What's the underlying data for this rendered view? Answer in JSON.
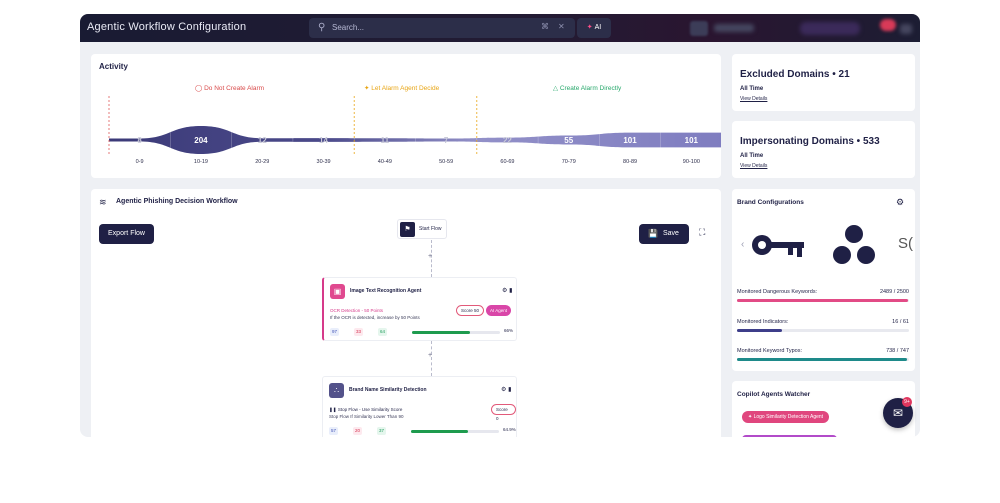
{
  "app": {
    "title": "Agentic Workflow Configuration"
  },
  "search": {
    "placeholder": "Search...",
    "ai_label": "AI"
  },
  "activity": {
    "title": "Activity",
    "zones": [
      {
        "label": "Do Not Create Alarm",
        "color": "#d94a4a"
      },
      {
        "label": "Let Alarm Agent Decide",
        "color": "#e8a514"
      },
      {
        "label": "Create Alarm Directly",
        "color": "#27a86b"
      }
    ],
    "bins": [
      "0-9",
      "10-19",
      "20-29",
      "30-39",
      "40-49",
      "50-59",
      "60-69",
      "70-79",
      "80-89",
      "90-100"
    ],
    "values": [
      8,
      204,
      12,
      14,
      11,
      7,
      22,
      55,
      101,
      101
    ]
  },
  "excluded_domains": {
    "title": "Excluded Domains • 21",
    "period": "All Time",
    "link": "View Details"
  },
  "impersonating_domains": {
    "title": "Impersonating Domains • 533",
    "period": "All Time",
    "link": "View Details"
  },
  "workflow": {
    "title": "Agentic Phishing Decision Workflow",
    "export_label": "Export Flow",
    "start_label": "Start Flow",
    "save_label": "Save",
    "plus": "+",
    "nodes": [
      {
        "title": "Image Text Recognition Agent",
        "line1": "OCR Detection - 50 Points",
        "line2": "If the OCR is detected, increase by 50 Points",
        "score": "Score 50",
        "agent": "AI Agent",
        "stat1": "97",
        "stat2": "33",
        "stat3": "64",
        "progress": 0.66,
        "progress_label": "66%"
      },
      {
        "title": "Brand Name Similarity Detection",
        "line1": "Stop Flow - Use Similarity Score",
        "line2": "Stop Flow If Similarity Lower Than 90",
        "score": "Score 0",
        "stat1": "57",
        "stat2": "20",
        "stat3": "37",
        "progress": 0.649,
        "progress_label": "64.9%"
      }
    ]
  },
  "brand": {
    "title": "Brand Configurations",
    "metrics": [
      {
        "label": "Monitored Dangerous Keywords:",
        "value": "2489 / 2500",
        "fraction": 0.9956,
        "color": "#e24b86"
      },
      {
        "label": "Monitored Indicators:",
        "value": "16 / 61",
        "fraction": 0.262,
        "color": "#3d3e8a"
      },
      {
        "label": "Monitored Keyword Typos:",
        "value": "738 / 747",
        "fraction": 0.988,
        "color": "#1e8a8a"
      }
    ]
  },
  "copilot": {
    "title": "Copilot Agents Watcher",
    "agent_label": "Logo Similarity Detection Agent"
  },
  "chat": {
    "badge": "9+"
  }
}
